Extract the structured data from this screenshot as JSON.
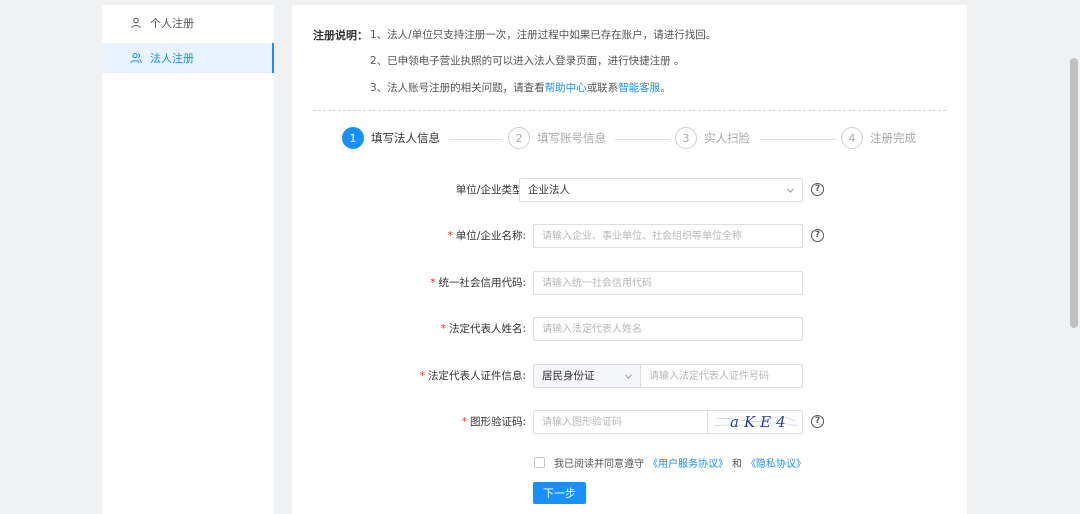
{
  "sidebar": {
    "items": [
      {
        "label": "个人注册",
        "active": false
      },
      {
        "label": "法人注册",
        "active": true
      }
    ]
  },
  "notes": {
    "title": "注册说明：",
    "line1": "1、法人/单位只支持注册一次，注册过程中如果已存在账户，请进行找回。",
    "line2": "2、已申领电子营业执照的可以进入法人登录页面，进行快捷注册 。",
    "line3_prefix": "3、法人账号注册的相关问题，请查看",
    "line3_link1": "帮助中心",
    "line3_mid": "或联系",
    "line3_link2": "智能客服",
    "line3_suffix": "。"
  },
  "steps": [
    {
      "num": "1",
      "label": "填写法人信息",
      "active": true
    },
    {
      "num": "2",
      "label": "填写账号信息",
      "active": false
    },
    {
      "num": "3",
      "label": "实人扫脸",
      "active": false
    },
    {
      "num": "4",
      "label": "注册完成",
      "active": false
    }
  ],
  "form": {
    "unit_type": {
      "label": "单位/企业类型:",
      "value": "企业法人"
    },
    "unit_name": {
      "label": "单位/企业名称:",
      "placeholder": "请输入企业、事业单位、社会组织等单位全称"
    },
    "credit_code": {
      "label": "统一社会信用代码:",
      "placeholder": "请输入统一社会信用代码"
    },
    "rep_name": {
      "label": "法定代表人姓名:",
      "placeholder": "请输入法定代表人姓名"
    },
    "rep_id": {
      "label": "法定代表人证件信息:",
      "id_type": "居民身份证",
      "placeholder": "请输入法定代表人证件号码"
    },
    "captcha": {
      "label": "图形验证码:",
      "placeholder": "请输入图形验证码",
      "image_text": "aKE4"
    },
    "required_mark": "*",
    "help_glyph": "?"
  },
  "agreement": {
    "prefix": "我已阅读并同意遵守",
    "link1": "《用户服务协议》",
    "and": "和",
    "link2": "《隐私协议》"
  },
  "next_button": "下一步",
  "colors": {
    "accent": "#1890ff",
    "required": "#f5222d"
  }
}
